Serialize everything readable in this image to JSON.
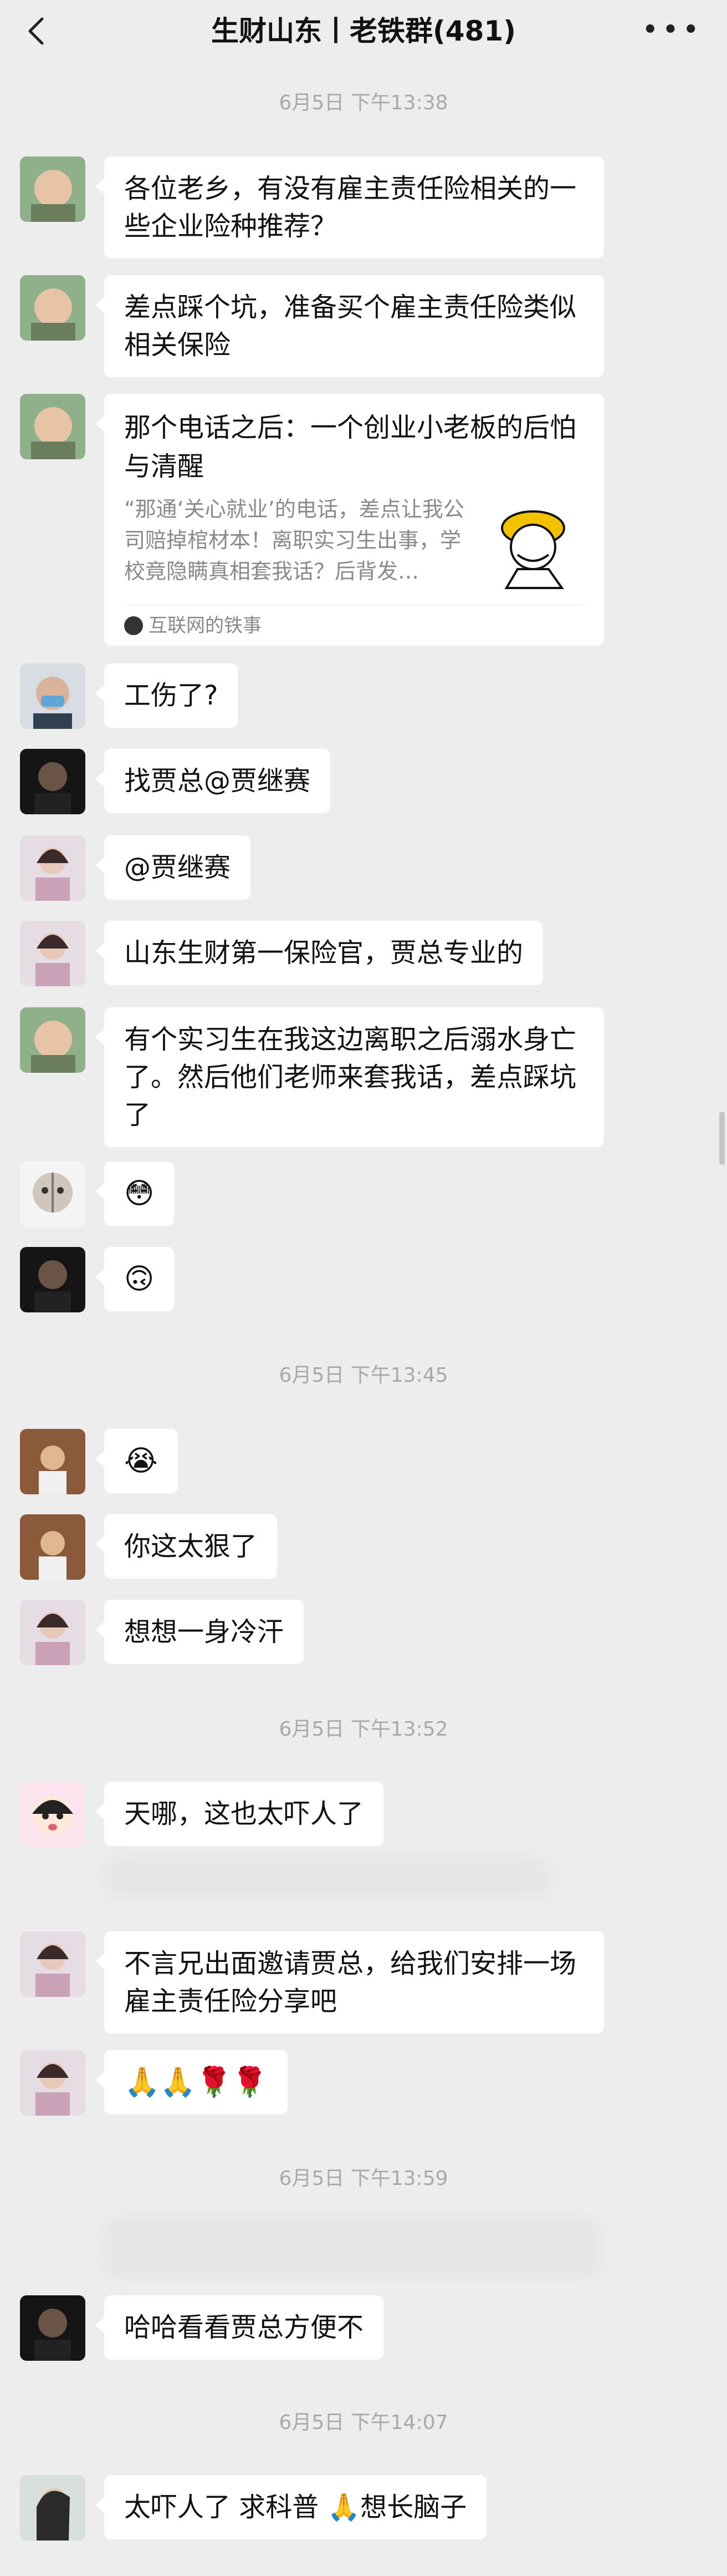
{
  "header": {
    "title": "生财山东丨老铁群(481)"
  },
  "timestamps": [
    "6月5日 下午13:38",
    "6月5日 下午13:45",
    "6月5日 下午13:52",
    "6月5日 下午13:59",
    "6月5日 下午14:07"
  ],
  "messages": [
    {
      "text": "各位老乡，有没有雇主责任险相关的一些企业险种推荐？"
    },
    {
      "text": "差点踩个坑，准备买个雇主责任险类似相关保险"
    },
    {
      "card": {
        "title": "那个电话之后：一个创业小老板的后怕与清醒",
        "desc": "“那通‘关心就业’的电话，差点让我公司赔掉棺材本！离职实习生出事，学校竟隐瞒真相套我话？后背发…",
        "source": "互联网的铁事"
      }
    },
    {
      "text": "工伤了?"
    },
    {
      "text": "找贾总@贾继赛"
    },
    {
      "text": "@贾继赛"
    },
    {
      "text": "山东生财第一保险官，贾总专业的"
    },
    {
      "text": "有个实习生在我这边离职之后溺水身亡了。然后他们老师来套我话，差点踩坑了"
    },
    {
      "text": "😳"
    },
    {
      "text": "🙃"
    },
    {
      "text": "😭"
    },
    {
      "text": "你这太狠了"
    },
    {
      "text": "想想一身冷汗"
    },
    {
      "text": "天哪，这也太吓人了"
    },
    {
      "text": "不言兄出面邀请贾总，给我们安排一场雇主责任险分享吧"
    },
    {
      "text": "🙏🙏🌹🌹"
    },
    {
      "text": "哈哈看看贾总方便不"
    },
    {
      "text": "太吓人了 求科普 🙏想长脑子"
    }
  ]
}
